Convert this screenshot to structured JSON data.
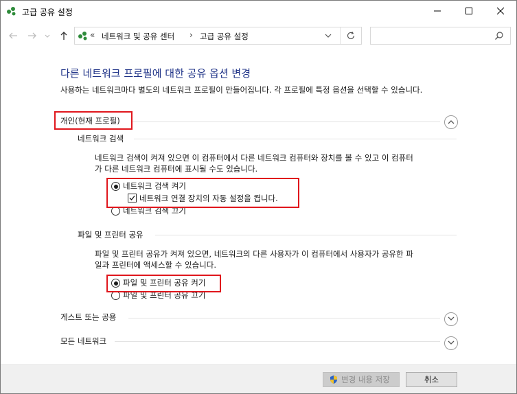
{
  "window": {
    "title": "고급 공유 설정"
  },
  "address": {
    "overflow_chevron": "«",
    "crumbs": [
      "네트워크 및 공유 센터",
      "고급 공유 설정"
    ],
    "separator": "›"
  },
  "search": {
    "placeholder": ""
  },
  "main": {
    "heading": "다른 네트워크 프로필에 대한 공유 옵션 변경",
    "intro": "사용하는 네트워크마다 별도의 네트워크 프로필이 만들어집니다. 각 프로필에 특정 옵션을 선택할 수 있습니다.",
    "profiles": {
      "private": {
        "label": "개인(현재 프로필)",
        "discovery": {
          "title": "네트워크 검색",
          "desc_line1": "네트워크 검색이 켜져 있으면 이 컴퓨터에서 다른 네트워크 컴퓨터와 장치를 볼 수 있고 이 컴퓨터",
          "desc_line2": "가 다른 네트워크 컴퓨터에 표시될 수도 있습니다.",
          "on_label": "네트워크 검색 켜기",
          "auto_setup_label": "네트워크 연결 장치의 자동 설정을 켭니다.",
          "off_label": "네트워크 검색 끄기",
          "selected": "on",
          "auto_setup_checked": true
        },
        "file_sharing": {
          "title": "파일 및 프린터 공유",
          "desc_line1": "파일 및 프린터 공유가 켜져 있으면, 네트워크의 다른 사용자가 이 컴퓨터에서 사용자가 공유한 파",
          "desc_line2": "일과 프린터에 액세스할 수 있습니다.",
          "on_label": "파일 및 프린터 공유 켜기",
          "off_label": "파일 및 프린터 공유 끄기",
          "selected": "on"
        }
      },
      "guest": {
        "label": "게스트 또는 공용"
      },
      "all": {
        "label": "모든 네트워크"
      }
    }
  },
  "footer": {
    "save_label": "변경 내용 저장",
    "cancel_label": "취소"
  },
  "colors": {
    "heading": "#1e3287",
    "highlight_box": "#e0161c",
    "footer_bg": "#f0f0f0"
  }
}
